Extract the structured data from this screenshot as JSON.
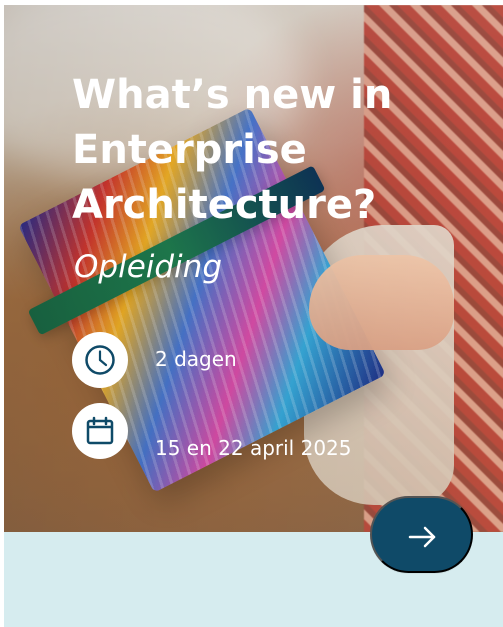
{
  "card": {
    "title_line_1": "What’s new in",
    "title_line_2": "Enterprise",
    "title_line_3": "Architecture?",
    "subtitle": "Opleiding",
    "duration": "2 dagen",
    "dates": "15 en 22 april 2025"
  },
  "icons": {
    "clock": "clock-icon",
    "calendar": "calendar-icon",
    "arrow": "arrow-right-icon"
  },
  "colors": {
    "text": "#ffffff",
    "icon_blue": "#0f4a68",
    "panel_background": "#d6ecef",
    "button_background": "#0f4a68"
  }
}
